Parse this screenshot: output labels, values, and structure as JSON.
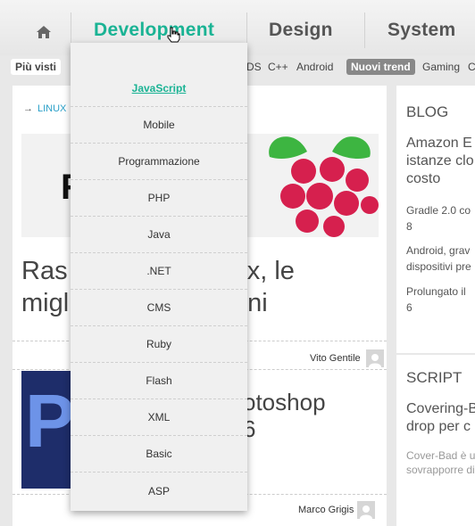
{
  "nav": {
    "home_icon": "home-icon",
    "items": [
      {
        "label": "Development",
        "active": true
      },
      {
        "label": "Design"
      },
      {
        "label": "System"
      }
    ]
  },
  "tagbar": {
    "piu_visti": "Più visti",
    "tags_left": [
      "DS",
      "C++",
      "Android"
    ],
    "nuovi_trend": "Nuovi trend",
    "tags_right": [
      "Gaming",
      "C"
    ]
  },
  "article1": {
    "category": "LINUX",
    "hero_text": "RY",
    "title_line1": "Ras",
    "title_line1_right": "ux, le",
    "title_line2": "migl",
    "title_line2_right": "ni",
    "author": "Vito Gentile"
  },
  "article2": {
    "title_line1": "otoshop",
    "title_line2": "6",
    "author": "Marco Grigis"
  },
  "sidebar": {
    "blog_heading": "BLOG",
    "blog_items": [
      {
        "lines": [
          "Amazon E",
          "istanze clo",
          "costo"
        ]
      },
      {
        "lines": [
          "Gradle 2.0 co",
          "8"
        ]
      },
      {
        "lines": [
          "Android, grav",
          "dispositivi pre"
        ]
      },
      {
        "lines": [
          "Prolungato il",
          "6"
        ]
      }
    ],
    "script_heading": "SCRIPT",
    "script_items": [
      {
        "lines": [
          "Covering-B",
          "drop per c"
        ]
      },
      {
        "lines": [
          "Cover-Bad è u",
          "sovrapporre di"
        ]
      }
    ]
  },
  "dropdown": {
    "items": [
      "JavaScript",
      "Mobile",
      "Programmazione",
      "PHP",
      "Java",
      ".NET",
      "CMS",
      "Ruby",
      "Flash",
      "XML",
      "Basic",
      "ASP"
    ],
    "active_index": 0
  },
  "colors": {
    "accent": "#1ab394",
    "link": "#2aa0c8",
    "raspberry": "#d6204e",
    "leaf": "#3db541",
    "photoshop_bg": "#1e2d6a"
  }
}
